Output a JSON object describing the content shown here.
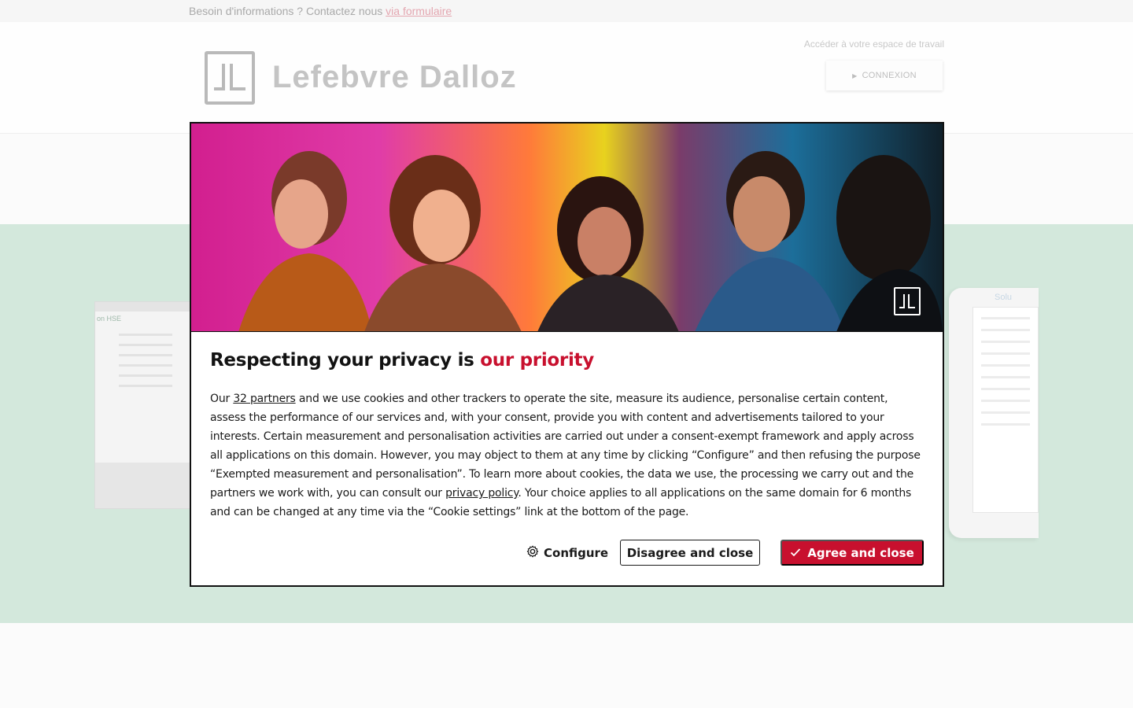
{
  "topbar": {
    "text": "Besoin d'informations ? Contactez nous",
    "link": "via formulaire"
  },
  "header": {
    "brand": "Lefebvre Dalloz",
    "workspace_text": "Accéder à votre espace de travail",
    "connexion_label": "CONNEXION"
  },
  "hero": {
    "laptop_title": "on HSE",
    "tablet_title": "Solu"
  },
  "modal": {
    "title_main": "Respecting your privacy is",
    "title_accent": "our priority",
    "body_before_partners": "Our",
    "partners_link": "32 partners",
    "body_middle": "and we use cookies and other trackers to operate the site, measure its audience, personalise certain content, assess the performance of our services and, with your consent, provide you with content and advertisements tailored to your interests. Certain measurement and personalisation activities are carried out under a consent-exempt framework and apply across all applications on this domain. However, you may object to them at any time by clicking “Configure” and then refusing the purpose “Exempted measurement and personalisation”. To learn more about cookies, the data we use, the processing we carry out and the partners we work with, you can consult our",
    "privacy_link": "privacy policy",
    "body_end": ". Your choice applies to all applications on the same domain for 6 months and can be changed at any time via the “Cookie settings” link at the bottom of the page.",
    "configure_label": "Configure",
    "disagree_label": "Disagree and close",
    "agree_label": "Agree and close"
  },
  "colors": {
    "accent": "#c8102e",
    "hero_bg": "#d3e8dc"
  },
  "icons": {
    "configure": "gear-icon",
    "agree": "check-icon",
    "connexion": "play-arrow-icon"
  }
}
